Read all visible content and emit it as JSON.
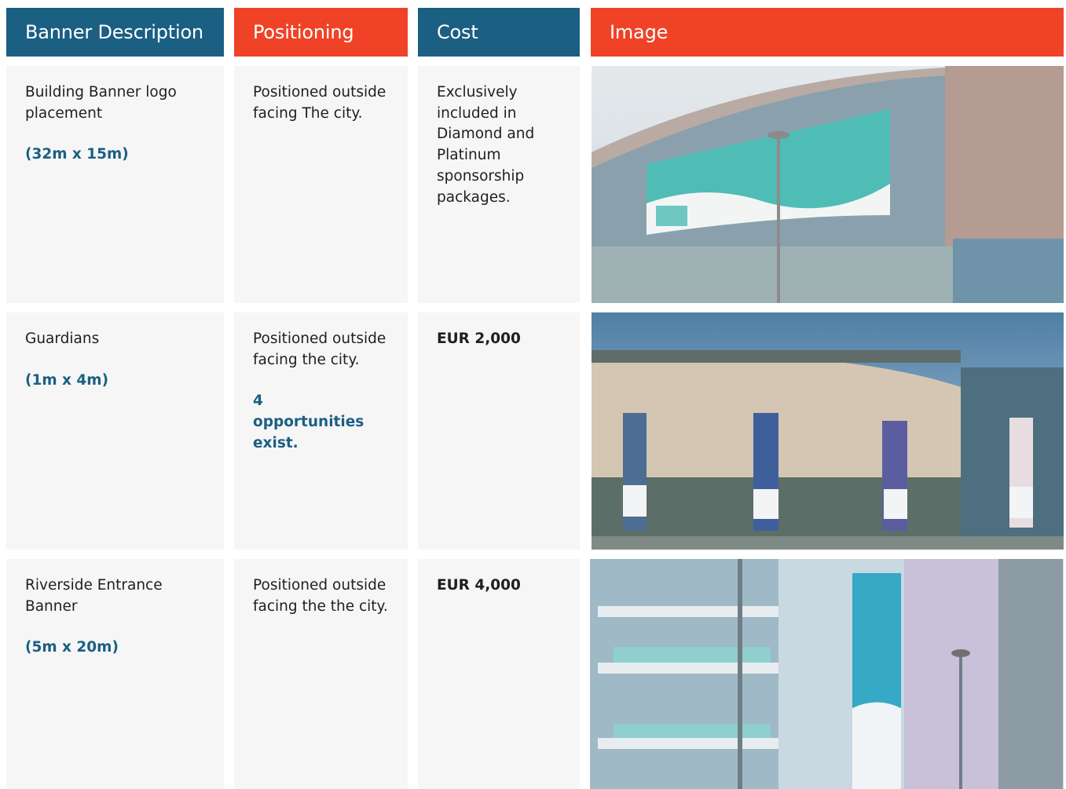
{
  "headers": {
    "description": "Banner Description",
    "positioning": "Positioning",
    "cost": "Cost",
    "image": "Image"
  },
  "rows": [
    {
      "description": "Building Banner logo placement",
      "size": "(32m x 15m)",
      "positioning": "Positioned outside facing The city.",
      "cost": "Exclusively included in Diamond and Platinum sponsorship packages."
    },
    {
      "description": "Guardians",
      "size": "(1m x 4m)",
      "positioning": "Positioned outside facing the city.",
      "note": "4 opportunities exist.",
      "cost": "EUR 2,000"
    },
    {
      "description": "Riverside Entrance Banner",
      "size": "(5m x 20m)",
      "positioning": "Positioned outside facing the the city.",
      "cost": "EUR 4,000"
    }
  ],
  "colors": {
    "header_blue": "#1b5f83",
    "header_red": "#ef4227",
    "cell_bg": "#f6f6f6",
    "accent_text": "#1b5f83"
  }
}
